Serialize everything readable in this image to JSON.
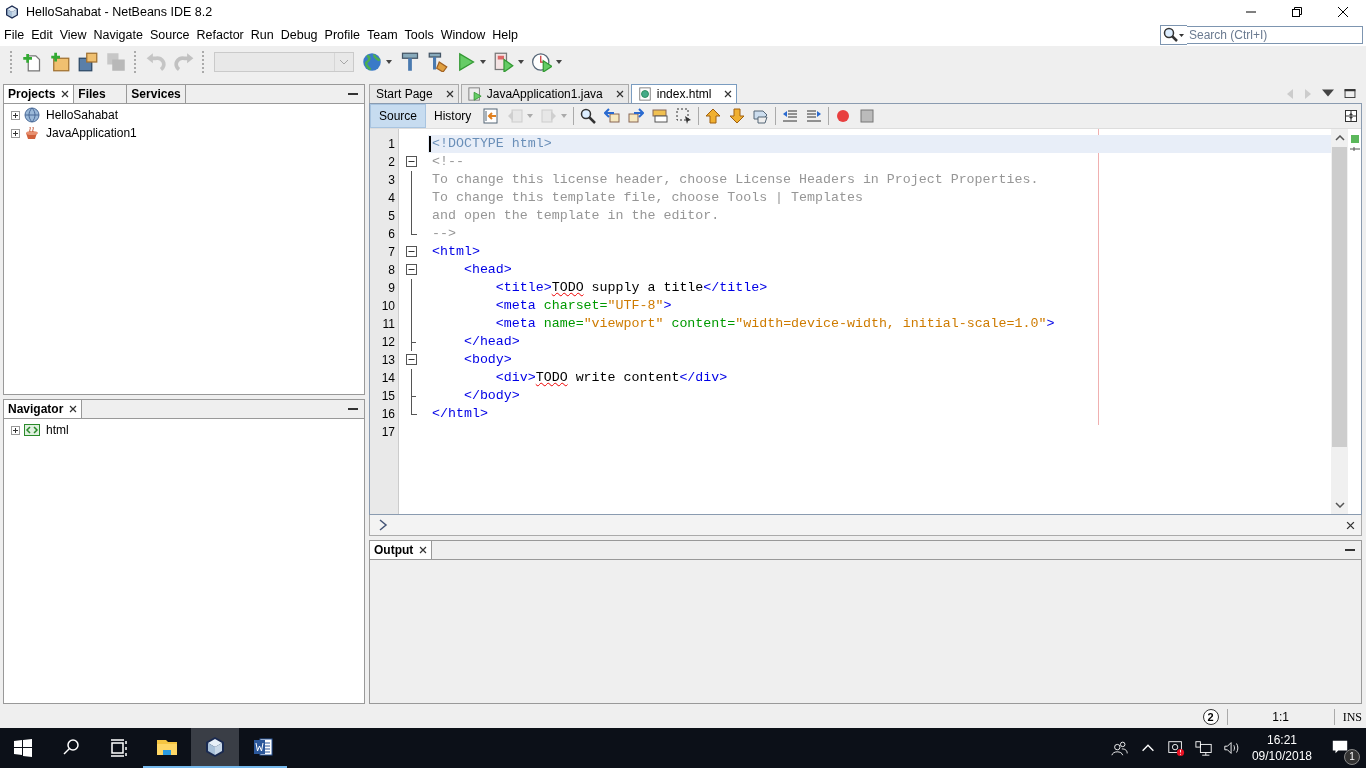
{
  "window": {
    "title": "HelloSahabat - NetBeans IDE 8.2"
  },
  "menu": [
    "File",
    "Edit",
    "View",
    "Navigate",
    "Source",
    "Refactor",
    "Run",
    "Debug",
    "Profile",
    "Team",
    "Tools",
    "Window",
    "Help"
  ],
  "search": {
    "placeholder": "Search (Ctrl+I)"
  },
  "toolbar": [
    {
      "kind": "new-file",
      "disabled": false,
      "dropdown": false
    },
    {
      "kind": "new-folder",
      "disabled": false,
      "dropdown": false
    },
    {
      "kind": "open-folder",
      "disabled": false,
      "dropdown": false
    },
    {
      "kind": "save-all",
      "disabled": true,
      "dropdown": false
    },
    {
      "kind": "separator"
    },
    {
      "kind": "undo",
      "disabled": true,
      "dropdown": false
    },
    {
      "kind": "redo",
      "disabled": true,
      "dropdown": false
    },
    {
      "kind": "separator"
    },
    {
      "kind": "combo",
      "disabled": true,
      "dropdown": true
    },
    {
      "kind": "globe",
      "disabled": false,
      "dropdown": true
    },
    {
      "kind": "hammer",
      "disabled": false,
      "dropdown": false
    },
    {
      "kind": "hammer-broom",
      "disabled": false,
      "dropdown": false
    },
    {
      "kind": "play",
      "disabled": false,
      "dropdown": true
    },
    {
      "kind": "page-play",
      "disabled": false,
      "dropdown": true
    },
    {
      "kind": "clock-play",
      "disabled": false,
      "dropdown": true
    }
  ],
  "projects_panel": {
    "tabs": [
      {
        "label": "Projects",
        "selected": true,
        "closable": true
      },
      {
        "label": "Files",
        "selected": false,
        "closable": false
      },
      {
        "label": "Services",
        "selected": false,
        "closable": false
      }
    ],
    "tree": [
      {
        "label": "HelloSahabat",
        "kind": "globe",
        "expanded": false
      },
      {
        "label": "JavaApplication1",
        "kind": "coffee",
        "expanded": false
      }
    ]
  },
  "navigator": {
    "tabs": [
      {
        "label": "Navigator",
        "selected": true,
        "closable": true
      }
    ],
    "tree": [
      {
        "label": "html",
        "kind": "tag",
        "expanded": false
      }
    ]
  },
  "editor": {
    "tabs": [
      {
        "label": "Start Page",
        "selected": false,
        "kind": "plain"
      },
      {
        "label": "JavaApplication1.java",
        "selected": false,
        "kind": "java"
      },
      {
        "label": "index.html",
        "selected": true,
        "kind": "html"
      }
    ],
    "views": [
      {
        "label": "Source",
        "selected": true
      },
      {
        "label": "History",
        "selected": false
      }
    ],
    "toolbar": [
      {
        "kind": "last-edit",
        "disabled": false,
        "dropdown": false
      },
      {
        "kind": "arrow-left",
        "disabled": true,
        "dropdown": true
      },
      {
        "kind": "arrow-right",
        "disabled": true,
        "dropdown": true
      },
      {
        "kind": "separator"
      },
      {
        "kind": "magnifier",
        "disabled": false,
        "dropdown": false
      },
      {
        "kind": "find-left",
        "disabled": false,
        "dropdown": false
      },
      {
        "kind": "find-right",
        "disabled": false,
        "dropdown": false
      },
      {
        "kind": "highlight",
        "disabled": false,
        "dropdown": false
      },
      {
        "kind": "rect-select",
        "disabled": false,
        "dropdown": false
      },
      {
        "kind": "separator"
      },
      {
        "kind": "bookmark-up",
        "disabled": false,
        "dropdown": false
      },
      {
        "kind": "bookmark-down",
        "disabled": false,
        "dropdown": false
      },
      {
        "kind": "bookmark-toggle",
        "disabled": false,
        "dropdown": false
      },
      {
        "kind": "separator"
      },
      {
        "kind": "shift-left",
        "disabled": false,
        "dropdown": false
      },
      {
        "kind": "shift-right",
        "disabled": false,
        "dropdown": false
      },
      {
        "kind": "separator"
      },
      {
        "kind": "record",
        "disabled": false,
        "dropdown": false
      },
      {
        "kind": "stop",
        "disabled": false,
        "dropdown": false
      }
    ],
    "lines": [
      {
        "number": "1",
        "current": true,
        "kind": "plain",
        "tokens": [
          {
            "t": "<!DOCTYPE html>",
            "kind": "decl",
            "misspelled": false
          }
        ]
      },
      {
        "number": "2",
        "current": false,
        "kind": "fold-start",
        "tokens": [
          {
            "t": "<!--",
            "kind": "comment",
            "misspelled": false
          }
        ]
      },
      {
        "number": "3",
        "current": false,
        "kind": "fold-body",
        "tokens": [
          {
            "t": "To change this license header, choose License Headers in Project Properties.",
            "kind": "comment",
            "misspelled": false
          }
        ]
      },
      {
        "number": "4",
        "current": false,
        "kind": "fold-body",
        "tokens": [
          {
            "t": "To change this template file, choose Tools | Templates",
            "kind": "comment",
            "misspelled": false
          }
        ]
      },
      {
        "number": "5",
        "current": false,
        "kind": "fold-body",
        "tokens": [
          {
            "t": "and open the template in the editor.",
            "kind": "comment",
            "misspelled": false
          }
        ]
      },
      {
        "number": "6",
        "current": false,
        "kind": "fold-end",
        "tokens": [
          {
            "t": "-->",
            "kind": "comment",
            "misspelled": false
          }
        ]
      },
      {
        "number": "7",
        "current": false,
        "kind": "fold-start",
        "tokens": [
          {
            "t": "<html>",
            "kind": "tag",
            "misspelled": false
          }
        ]
      },
      {
        "number": "8",
        "current": false,
        "kind": "fold-start",
        "tokens": [
          {
            "t": "    <head>",
            "kind": "tag",
            "misspelled": false
          }
        ]
      },
      {
        "number": "9",
        "current": false,
        "kind": "fold-body",
        "tokens": [
          {
            "t": "        <title>",
            "kind": "tag",
            "misspelled": false
          },
          {
            "t": "TODO",
            "kind": "text",
            "misspelled": true
          },
          {
            "t": " supply a title",
            "kind": "text",
            "misspelled": false
          },
          {
            "t": "</title>",
            "kind": "tag",
            "misspelled": false
          }
        ]
      },
      {
        "number": "10",
        "current": false,
        "kind": "fold-body",
        "tokens": [
          {
            "t": "        <meta ",
            "kind": "tag",
            "misspelled": false
          },
          {
            "t": "charset=",
            "kind": "attr",
            "misspelled": false
          },
          {
            "t": "\"UTF-8\"",
            "kind": "value",
            "misspelled": false
          },
          {
            "t": ">",
            "kind": "tag",
            "misspelled": false
          }
        ]
      },
      {
        "number": "11",
        "current": false,
        "kind": "fold-body",
        "tokens": [
          {
            "t": "        <meta ",
            "kind": "tag",
            "misspelled": false
          },
          {
            "t": "name=",
            "kind": "attr",
            "misspelled": false
          },
          {
            "t": "\"viewport\"",
            "kind": "value",
            "misspelled": false
          },
          {
            "t": " content=",
            "kind": "attr",
            "misspelled": false
          },
          {
            "t": "\"width=device-width, initial-scale=1.0\"",
            "kind": "value",
            "misspelled": false
          },
          {
            "t": ">",
            "kind": "tag",
            "misspelled": false
          }
        ]
      },
      {
        "number": "12",
        "current": false,
        "kind": "fold-branch",
        "tokens": [
          {
            "t": "    </head>",
            "kind": "tag",
            "misspelled": false
          }
        ]
      },
      {
        "number": "13",
        "current": false,
        "kind": "fold-start",
        "tokens": [
          {
            "t": "    <body>",
            "kind": "tag",
            "misspelled": false
          }
        ]
      },
      {
        "number": "14",
        "current": false,
        "kind": "fold-body",
        "tokens": [
          {
            "t": "        <div>",
            "kind": "tag",
            "misspelled": false
          },
          {
            "t": "TODO",
            "kind": "text",
            "misspelled": true
          },
          {
            "t": " write content",
            "kind": "text",
            "misspelled": false
          },
          {
            "t": "</div>",
            "kind": "tag",
            "misspelled": false
          }
        ]
      },
      {
        "number": "15",
        "current": false,
        "kind": "fold-branch",
        "tokens": [
          {
            "t": "    </body>",
            "kind": "tag",
            "misspelled": false
          }
        ]
      },
      {
        "number": "16",
        "current": false,
        "kind": "fold-end",
        "tokens": [
          {
            "t": "</html>",
            "kind": "tag",
            "misspelled": false
          }
        ]
      },
      {
        "number": "17",
        "current": false,
        "kind": "plain"
      }
    ]
  },
  "output": {
    "tabs": [
      {
        "label": "Output",
        "selected": true,
        "closable": true
      }
    ]
  },
  "status_bar": {
    "notifications": "2",
    "position": "1:1",
    "mode": "INS"
  },
  "taskbar": {
    "apps": [
      {
        "kind": "folder",
        "active": false,
        "running": true
      },
      {
        "kind": "cube",
        "active": true,
        "running": true
      },
      {
        "kind": "word",
        "active": false,
        "running": true
      }
    ],
    "time": "16:21",
    "date": "09/10/2018",
    "notification_count": "1"
  }
}
